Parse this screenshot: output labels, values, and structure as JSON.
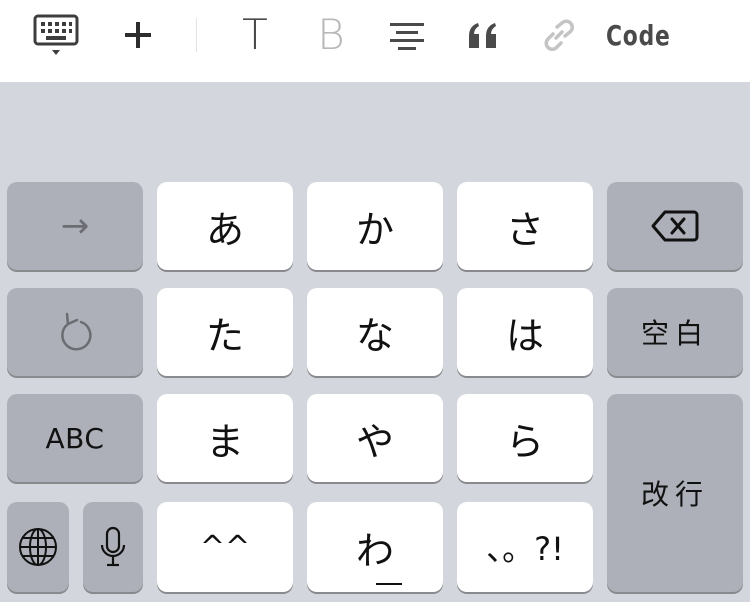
{
  "toolbar": {
    "icons": [
      "keyboard-dismiss-icon",
      "plus-icon",
      "link-icon"
    ],
    "text_label": "T",
    "bold_label": "B",
    "align_label": "≡",
    "quote_label": "❝",
    "code_label": "Code",
    "colors": {
      "dark": "#3d3d3d",
      "disabled": "#b8b8b8"
    }
  },
  "keyboard": {
    "rows": [
      {
        "left": "→",
        "keys": [
          "あ",
          "か",
          "さ"
        ],
        "right_icon": "backspace-icon"
      },
      {
        "left_icon": "undo-icon",
        "keys": [
          "た",
          "な",
          "は"
        ],
        "right": "空白"
      },
      {
        "left": "ABC",
        "keys": [
          "ま",
          "や",
          "ら"
        ],
        "right": "改行"
      },
      {
        "left_icons": [
          "globe-icon",
          "microphone-icon"
        ],
        "keys": [
          "^^",
          "わ",
          "、。?!"
        ]
      }
    ],
    "colors": {
      "letter_key": "#ffffff",
      "function_key": "#adb0b8",
      "background": "#d3d6dc"
    }
  }
}
